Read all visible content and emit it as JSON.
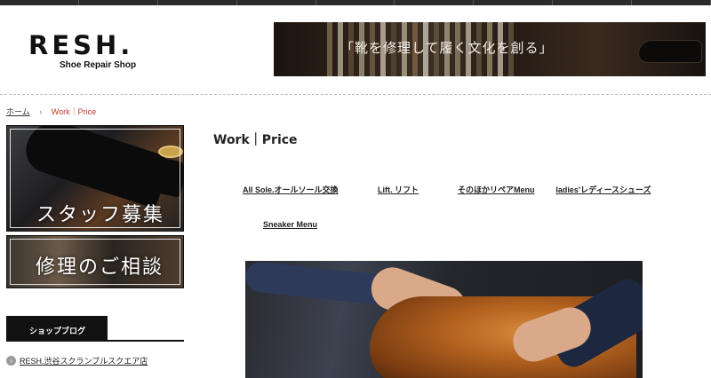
{
  "logo": {
    "name": "RESH.",
    "tagline": "Shoe Repair Shop"
  },
  "hero": {
    "caption": "「靴を修理して履く文化を創る」"
  },
  "breadcrumb": {
    "home": "ホーム",
    "separator": "›",
    "current": "Work｜Price"
  },
  "sidebar": {
    "banners": [
      {
        "label": "スタッフ募集"
      },
      {
        "label": "修理のご相談"
      }
    ],
    "blog_tab": "ショップブログ",
    "blog_items": [
      {
        "label": "RESH.渋谷スクランブルスクエア店"
      }
    ]
  },
  "main": {
    "title": "Work｜Price",
    "menu": [
      {
        "label": "All Sole.オールソール交換"
      },
      {
        "label": "Lift. リフト"
      },
      {
        "label": "そのほかリペアMenu"
      },
      {
        "label": "ladies'レディースシューズ"
      },
      {
        "label": "Sneaker Menu"
      }
    ]
  },
  "colors": {
    "accent": "#c0392b",
    "dark": "#111111",
    "topbar": "#2b2b2b"
  },
  "icons": {
    "blog_bullet": "chevron-right-circle-icon"
  }
}
